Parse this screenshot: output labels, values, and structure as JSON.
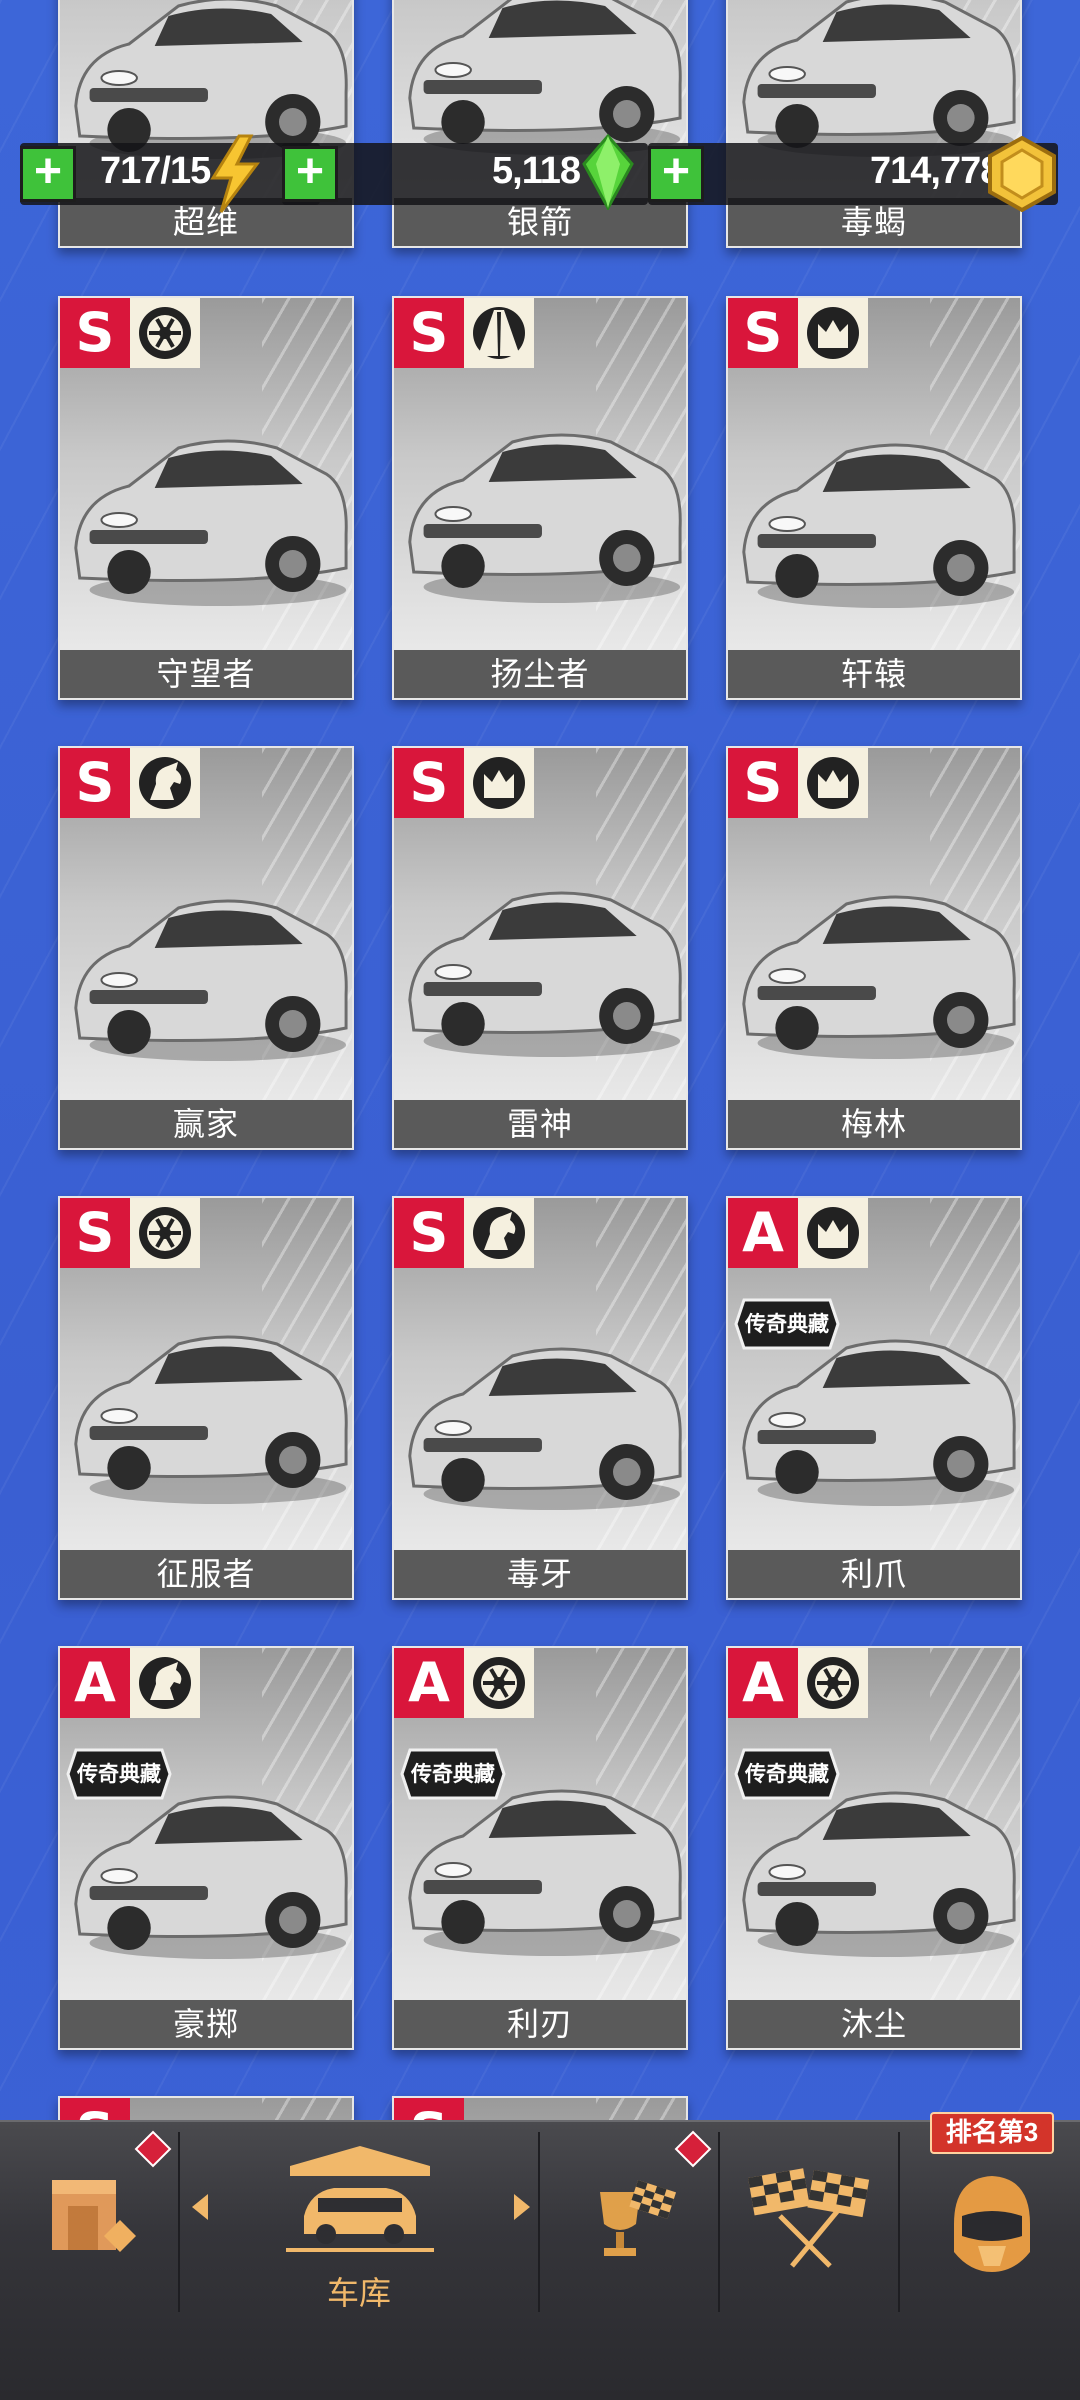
{
  "resources": {
    "energy": "717/15",
    "gems": "5,118",
    "coins": "714,778"
  },
  "top_row_partial": [
    "超维",
    "银箭",
    "毒蝎"
  ],
  "cars": [
    {
      "name": "守望者",
      "grade": "S",
      "category": "wheel-icon",
      "legend": ""
    },
    {
      "name": "扬尘者",
      "grade": "S",
      "category": "road-icon",
      "legend": ""
    },
    {
      "name": "轩辕",
      "grade": "S",
      "category": "crown-icon",
      "legend": ""
    },
    {
      "name": "赢家",
      "grade": "S",
      "category": "horse-icon",
      "legend": ""
    },
    {
      "name": "雷神",
      "grade": "S",
      "category": "crown-icon",
      "legend": ""
    },
    {
      "name": "梅林",
      "grade": "S",
      "category": "crown-icon",
      "legend": ""
    },
    {
      "name": "征服者",
      "grade": "S",
      "category": "wheel-icon",
      "legend": ""
    },
    {
      "name": "毒牙",
      "grade": "S",
      "category": "horse-icon",
      "legend": ""
    },
    {
      "name": "利爪",
      "grade": "A",
      "category": "crown-icon",
      "legend": "传奇典藏"
    },
    {
      "name": "豪掷",
      "grade": "A",
      "category": "horse-icon",
      "legend": "传奇典藏"
    },
    {
      "name": "利刃",
      "grade": "A",
      "category": "wheel-icon",
      "legend": "传奇典藏"
    },
    {
      "name": "沐尘",
      "grade": "A",
      "category": "wheel-icon",
      "legend": "传奇典藏"
    }
  ],
  "bottom_partial": [
    {
      "grade": "S"
    },
    {
      "grade": "S"
    }
  ],
  "nav": {
    "garage_label": "车库",
    "rank_badge": "排名第3"
  },
  "colors": {
    "background": "#3c63d6",
    "grade_red": "#d9163b",
    "nav_accent": "#f1b86a"
  }
}
